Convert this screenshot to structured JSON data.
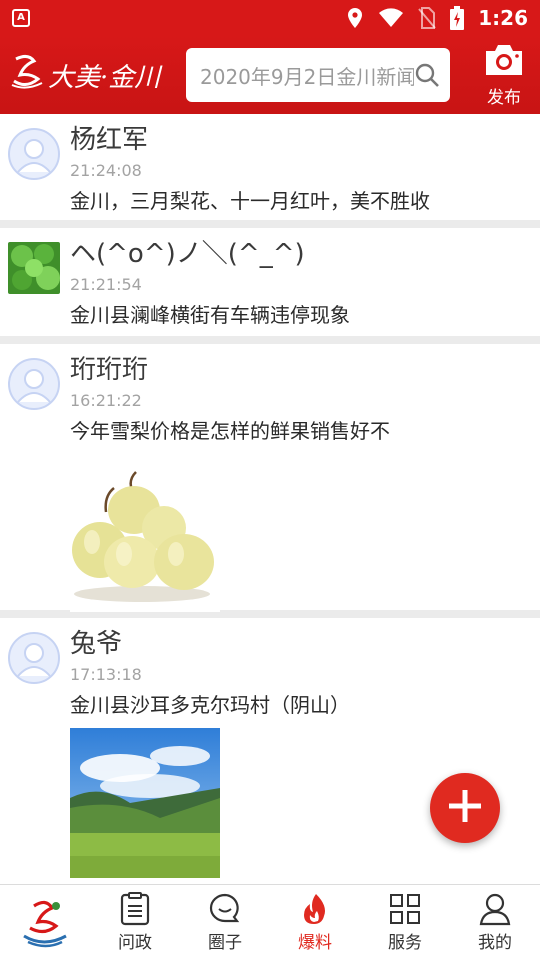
{
  "status_bar": {
    "app_icon_letter": "A",
    "time": "1:26"
  },
  "header": {
    "logo_text": "大美·金川",
    "search_placeholder": "2020年9月2日金川新闻",
    "publish_label": "发布"
  },
  "feed": {
    "posts": [
      {
        "username": "杨红军",
        "time": "21:24:08",
        "content": "金川，三月梨花、十一月红叶，美不胜收"
      },
      {
        "username": "ヘ(^o^)ノ＼(^_^)",
        "time": "21:21:54",
        "content": "金川县澜峰横街有车辆违停现象"
      },
      {
        "username": "珩珩珩",
        "time": "16:21:22",
        "content": "今年雪梨价格是怎样的鲜果销售好不"
      },
      {
        "username": "兔爷",
        "time": "17:13:18",
        "content": "金川县沙耳多克尔玛村（阴山）"
      }
    ]
  },
  "bottom_nav": {
    "items": [
      {
        "label": "问政"
      },
      {
        "label": "圈子"
      },
      {
        "label": "爆料"
      },
      {
        "label": "服务"
      },
      {
        "label": "我的"
      }
    ],
    "active_index": 2
  },
  "colors": {
    "brand_red": "#d71818",
    "fab_red": "#e02a20"
  }
}
